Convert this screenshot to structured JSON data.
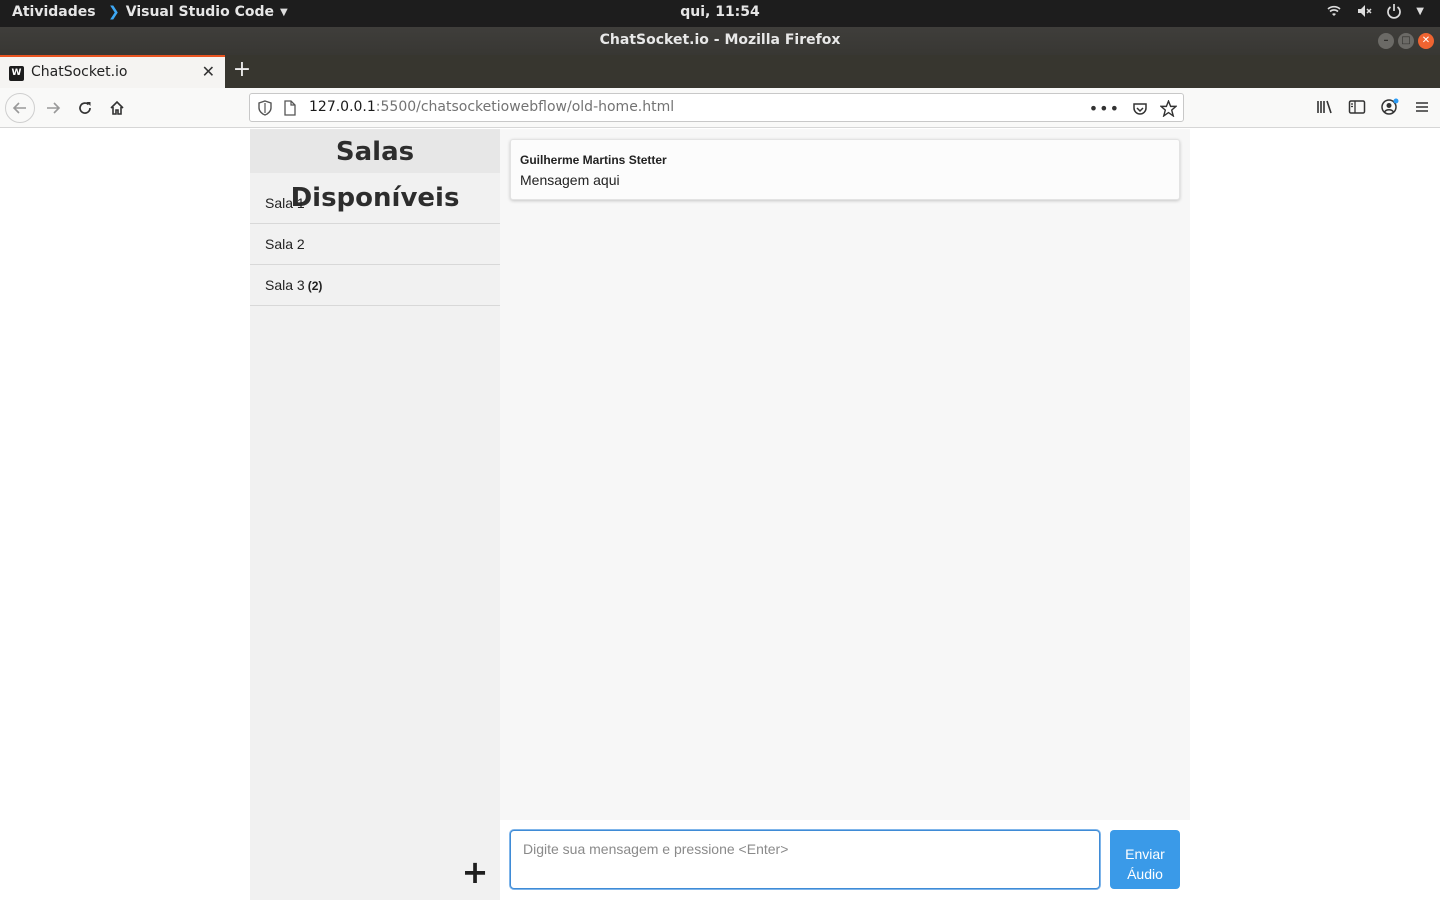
{
  "system": {
    "activities": "Atividades",
    "app_name": "Visual Studio Code",
    "clock": "qui, 11:54"
  },
  "window": {
    "title": "ChatSocket.io - Mozilla Firefox"
  },
  "browser": {
    "tab_title": "ChatSocket.io",
    "favicon_letter": "W",
    "url_host": "127.0.0.1",
    "url_path": ":5500/chatsocketiowebflow/old-home.html"
  },
  "sidebar": {
    "title": "Salas Disponíveis",
    "rooms": [
      {
        "label": "Sala 1",
        "count": ""
      },
      {
        "label": "Sala 2",
        "count": ""
      },
      {
        "label": "Sala 3",
        "count": "(2)"
      }
    ],
    "add_symbol": "+"
  },
  "chat": {
    "messages": [
      {
        "author": "Guilherme Martins Stetter",
        "text": "Mensagem aqui"
      }
    ]
  },
  "composer": {
    "placeholder": "Digite sua mensagem e pressione <Enter>",
    "send_audio_label": "Enviar\nÁudio"
  }
}
